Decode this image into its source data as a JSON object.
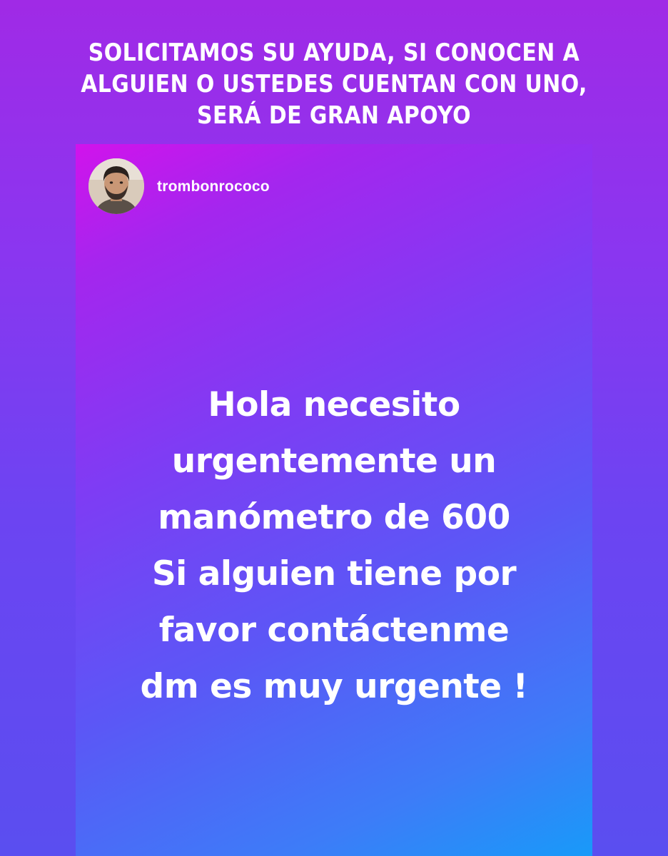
{
  "headline": {
    "lines": [
      "SOLICITAMOS SU AYUDA, SI CONOCEN A",
      "ALGUIEN O USTEDES CUENTAN CON UNO,",
      "SERÁ DE GRAN APOYO"
    ]
  },
  "story": {
    "username": "trombonrococo",
    "avatar_icon": "profile-photo",
    "message_lines": [
      "Hola necesito",
      "urgentemente un",
      "manómetro de 600",
      "Si alguien tiene por",
      "favor contáctenme",
      "dm  es muy urgente !"
    ]
  },
  "colors": {
    "background_top": "#a02ae6",
    "story_gradient_start": "#d113ec",
    "story_gradient_end": "#189af9",
    "text": "#ffffff"
  }
}
